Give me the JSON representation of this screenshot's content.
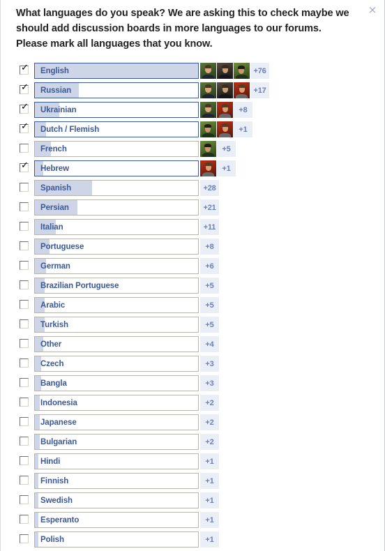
{
  "dialog": {
    "question": "What languages do you speak? We are asking this to check maybe we should add discussion boards in more languages to our forums. Please mark all languages that you know.",
    "close_label": "×",
    "accent_color": "#3b5998",
    "fill_color": "#ced5e6",
    "badge_bg": "#eaeef6",
    "badge_text_color": "#6b7fb3"
  },
  "languages": [
    {
      "name": "English",
      "count": "+76",
      "fill_pct": 100,
      "checked": true,
      "avatars": [
        "a1",
        "a2",
        "a3"
      ]
    },
    {
      "name": "Russian",
      "count": "+17",
      "fill_pct": 27,
      "checked": true,
      "avatars": [
        "a1",
        "a2",
        "a4"
      ]
    },
    {
      "name": "Ukrainian",
      "count": "+8",
      "fill_pct": 15,
      "checked": true,
      "avatars": [
        "a1",
        "a4"
      ]
    },
    {
      "name": "Dutch / Flemish",
      "count": "+1",
      "fill_pct": 7,
      "checked": true,
      "avatars": [
        "a3",
        "a4"
      ]
    },
    {
      "name": "French",
      "count": "+5",
      "fill_pct": 10,
      "checked": false,
      "avatars": [
        "a3"
      ]
    },
    {
      "name": "Hebrew",
      "count": "+1",
      "fill_pct": 5,
      "checked": true,
      "avatars": [
        "a4"
      ]
    },
    {
      "name": "Spanish",
      "count": "+28",
      "fill_pct": 35,
      "checked": false,
      "avatars": []
    },
    {
      "name": "Persian",
      "count": "+21",
      "fill_pct": 26,
      "checked": false,
      "avatars": []
    },
    {
      "name": "Italian",
      "count": "+11",
      "fill_pct": 13,
      "checked": false,
      "avatars": []
    },
    {
      "name": "Portuguese",
      "count": "+8",
      "fill_pct": 9,
      "checked": false,
      "avatars": []
    },
    {
      "name": "German",
      "count": "+6",
      "fill_pct": 7,
      "checked": false,
      "avatars": []
    },
    {
      "name": "Brazilian Portuguese",
      "count": "+5",
      "fill_pct": 6,
      "checked": false,
      "avatars": []
    },
    {
      "name": "Arabic",
      "count": "+5",
      "fill_pct": 6,
      "checked": false,
      "avatars": []
    },
    {
      "name": "Turkish",
      "count": "+5",
      "fill_pct": 6,
      "checked": false,
      "avatars": []
    },
    {
      "name": "Other",
      "count": "+4",
      "fill_pct": 5,
      "checked": false,
      "avatars": []
    },
    {
      "name": "Czech",
      "count": "+3",
      "fill_pct": 4,
      "checked": false,
      "avatars": []
    },
    {
      "name": "Bangla",
      "count": "+3",
      "fill_pct": 4,
      "checked": false,
      "avatars": []
    },
    {
      "name": "Indonesia",
      "count": "+2",
      "fill_pct": 3,
      "checked": false,
      "avatars": []
    },
    {
      "name": "Japanese",
      "count": "+2",
      "fill_pct": 3,
      "checked": false,
      "avatars": []
    },
    {
      "name": "Bulgarian",
      "count": "+2",
      "fill_pct": 3,
      "checked": false,
      "avatars": []
    },
    {
      "name": "Hindi",
      "count": "+1",
      "fill_pct": 2,
      "checked": false,
      "avatars": []
    },
    {
      "name": "Finnish",
      "count": "+1",
      "fill_pct": 2,
      "checked": false,
      "avatars": []
    },
    {
      "name": "Swedish",
      "count": "+1",
      "fill_pct": 2,
      "checked": false,
      "avatars": []
    },
    {
      "name": "Esperanto",
      "count": "+1",
      "fill_pct": 2,
      "checked": false,
      "avatars": []
    },
    {
      "name": "Polish",
      "count": "+1",
      "fill_pct": 2,
      "checked": false,
      "avatars": []
    }
  ]
}
